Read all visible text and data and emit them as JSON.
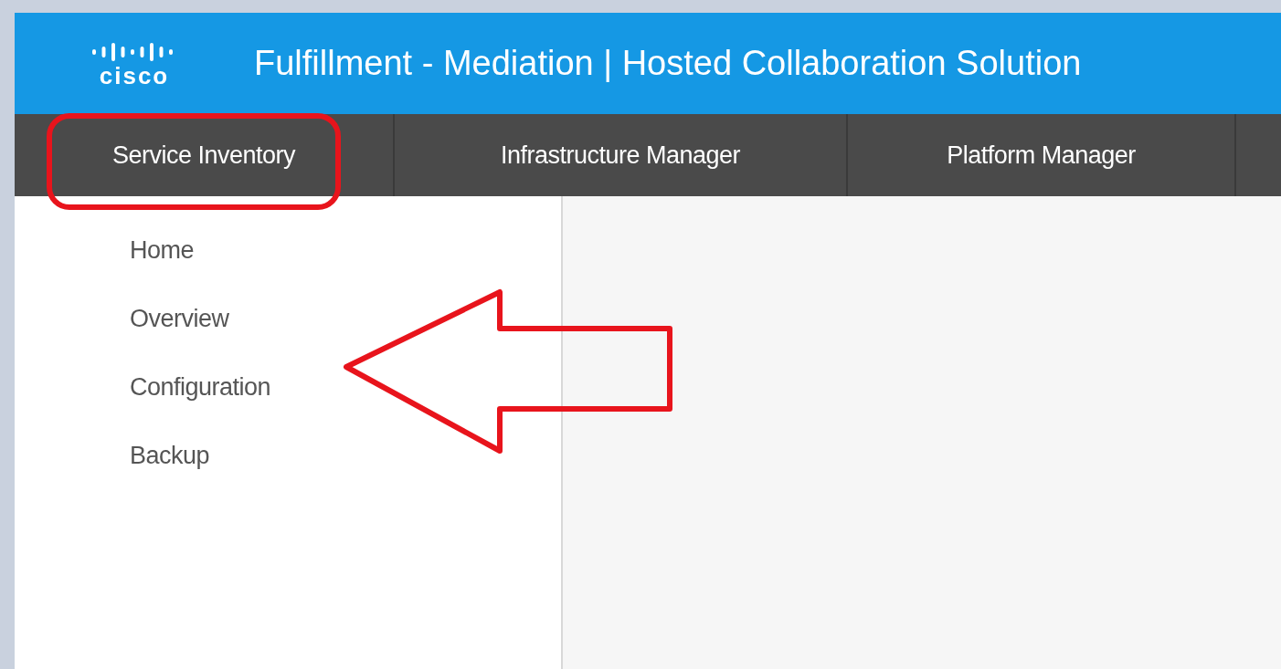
{
  "header": {
    "logo_text": "cisco",
    "title": "Fulfillment - Mediation | Hosted Collaboration Solution"
  },
  "nav_tabs": [
    "Service Inventory",
    "Infrastructure Manager",
    "Platform Manager"
  ],
  "sidebar": {
    "items": [
      "Home",
      "Overview",
      "Configuration",
      "Backup"
    ]
  }
}
